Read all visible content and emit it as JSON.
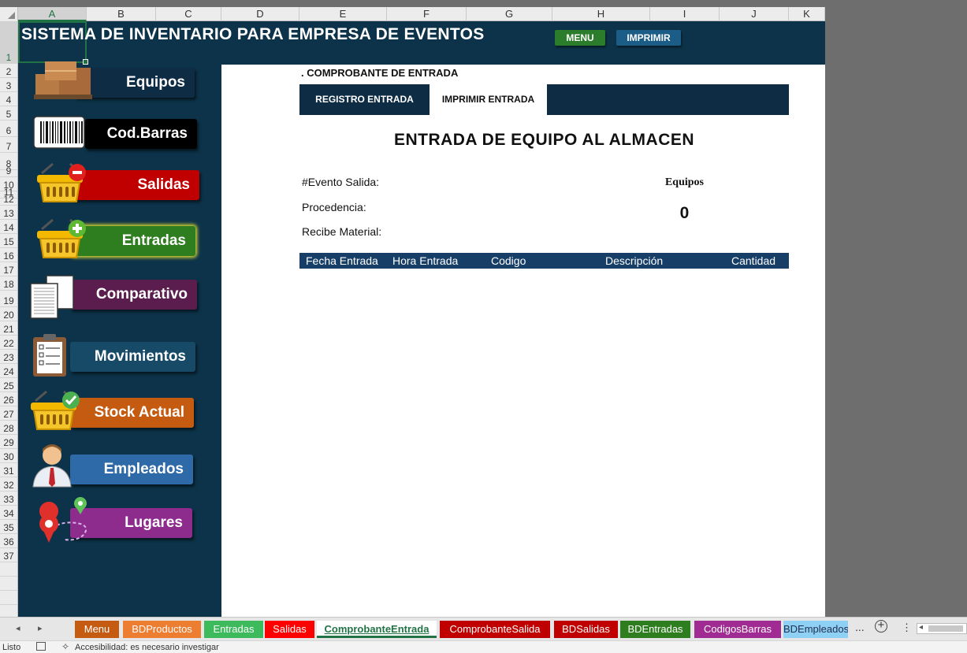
{
  "columns": [
    "A",
    "B",
    "C",
    "D",
    "E",
    "F",
    "G",
    "H",
    "I",
    "J",
    "K"
  ],
  "rows": [
    "1",
    "2",
    "3",
    "4",
    "5",
    "6",
    "7",
    "8",
    "9",
    "10",
    "11",
    "12",
    "13",
    "14",
    "15",
    "16",
    "17",
    "18",
    "19",
    "20",
    "21",
    "22",
    "23",
    "24",
    "25",
    "26",
    "27",
    "28",
    "29",
    "30",
    "31",
    "32",
    "33",
    "34",
    "35",
    "36",
    "37"
  ],
  "header": {
    "title": "SISTEMA DE INVENTARIO PARA EMPRESA DE EVENTOS",
    "menu_label": "MENU",
    "print_label": "IMPRIMIR"
  },
  "nav": [
    {
      "label": "Equipos",
      "color": "#0f2c45",
      "icon": "boxes-icon"
    },
    {
      "label": "Cod.Barras",
      "color": "#000000",
      "icon": "barcode-icon"
    },
    {
      "label": "Salidas",
      "color": "#c00000",
      "icon": "basket-minus-icon"
    },
    {
      "label": "Entradas",
      "color": "#2e7d1f",
      "icon": "basket-plus-icon"
    },
    {
      "label": "Comparativo",
      "color": "#5a1d4e",
      "icon": "documents-icon"
    },
    {
      "label": "Movimientos",
      "color": "#174a66",
      "icon": "clipboard-icon"
    },
    {
      "label": "Stock Actual",
      "color": "#c55a11",
      "icon": "basket-check-icon"
    },
    {
      "label": "Empleados",
      "color": "#2f6aa8",
      "icon": "person-icon"
    },
    {
      "label": "Lugares",
      "color": "#8e2c8e",
      "icon": "location-pin-icon"
    }
  ],
  "form": {
    "section_title": ". COMPROBANTE DE ENTRADA",
    "tabs": [
      "REGISTRO ENTRADA",
      "IMPRIMIR ENTRADA"
    ],
    "heading": "ENTRADA DE EQUIPO AL ALMACEN",
    "evento_label": "#Evento Salida:",
    "procedencia_label": "Procedencia:",
    "recibe_label": "Recibe Material:",
    "equipos_label": "Equipos",
    "equipos_value": "0",
    "table_headers": [
      "Fecha Entrada",
      "Hora Entrada",
      "Codigo",
      "Descripción",
      "Cantidad"
    ]
  },
  "sheet_tabs": [
    {
      "label": "Menu",
      "color": "#c55a11"
    },
    {
      "label": "BDProductos",
      "color": "#ed7d31"
    },
    {
      "label": "Entradas",
      "color": "#3dba5c"
    },
    {
      "label": "Salidas",
      "color": "#ff0000"
    },
    {
      "label": "ComprobanteEntrada",
      "color": "#ffffff",
      "active": true
    },
    {
      "label": "ComprobanteSalida",
      "color": "#c00000"
    },
    {
      "label": "BDSalidas",
      "color": "#c00000"
    },
    {
      "label": "BDEntradas",
      "color": "#2e7d1f"
    },
    {
      "label": "CodigosBarras",
      "color": "#a02b93"
    },
    {
      "label": "BDEmpleados",
      "color": "#8fd0f5"
    }
  ],
  "tabbar_more": "...",
  "status": {
    "ready": "Listo",
    "accessibility": "Accesibilidad: es necesario investigar"
  }
}
